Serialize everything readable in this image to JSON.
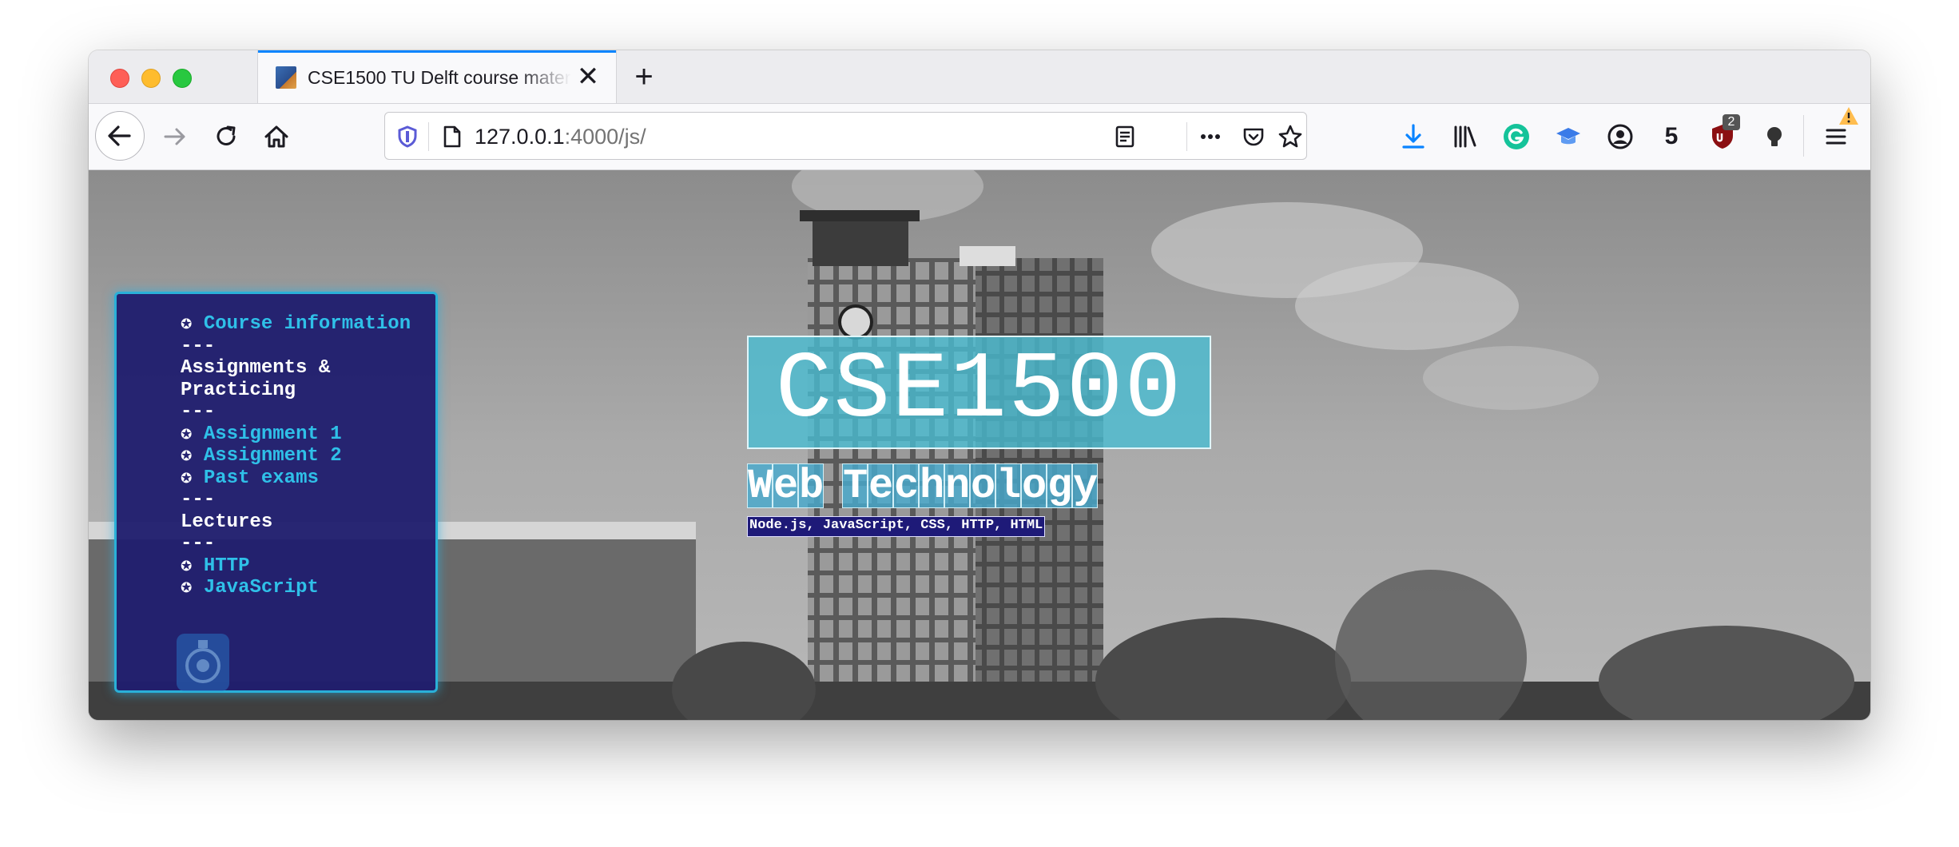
{
  "browser": {
    "tab_title": "CSE1500 TU Delft course material",
    "new_tab_label": "+",
    "close_label": "✕",
    "url_host": "127.0.0.1",
    "url_path": ":4000/js/",
    "badge_count": "5",
    "ublock_badge": "2"
  },
  "sidebar": {
    "items": [
      {
        "type": "link",
        "label": "Course information"
      },
      {
        "type": "sep",
        "label": "---"
      },
      {
        "type": "heading",
        "label": "Assignments & Practicing"
      },
      {
        "type": "sep",
        "label": "---"
      },
      {
        "type": "link",
        "label": "Assignment 1"
      },
      {
        "type": "link",
        "label": "Assignment 2"
      },
      {
        "type": "link",
        "label": "Past exams"
      },
      {
        "type": "sep",
        "label": "---"
      },
      {
        "type": "heading",
        "label": "Lectures"
      },
      {
        "type": "sep",
        "label": "---"
      },
      {
        "type": "link",
        "label": "HTTP"
      },
      {
        "type": "link",
        "label": "JavaScript"
      }
    ]
  },
  "hero": {
    "title": "CSE1500",
    "subtitle": "Web Technology",
    "tags": "Node.js, JavaScript, CSS, HTTP, HTML"
  },
  "colors": {
    "sidebar_bg": "#201e6e",
    "sidebar_border": "#2ab0d8",
    "link": "#2fc0e8",
    "hero_box": "#48bed4",
    "tags_bg": "#1e1a78",
    "tab_accent": "#0a84ff"
  }
}
